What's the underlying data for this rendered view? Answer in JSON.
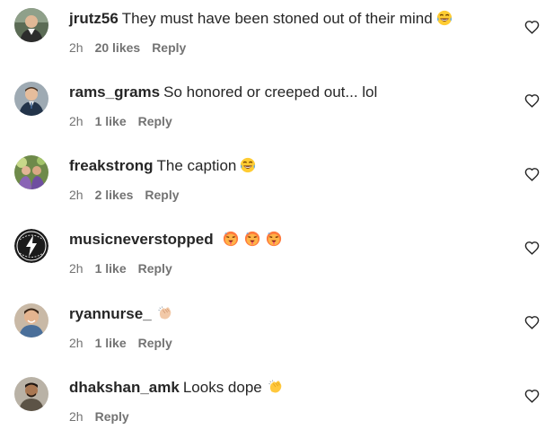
{
  "comments": [
    {
      "username": "jrutz56",
      "text": "They must have been stoned out of their mind",
      "emojis": [
        "laughing-tears-emoji"
      ],
      "time": "2h",
      "likes": "20 likes",
      "reply": "Reply",
      "avatar_icon": "avatar-photo"
    },
    {
      "username": "rams_grams",
      "text": "So honored or creeped out... lol",
      "emojis": [],
      "time": "2h",
      "likes": "1 like",
      "reply": "Reply",
      "avatar_icon": "avatar-photo"
    },
    {
      "username": "freakstrong",
      "text": "The caption",
      "emojis": [
        "laughing-tears-emoji"
      ],
      "time": "2h",
      "likes": "2 likes",
      "reply": "Reply",
      "avatar_icon": "avatar-photo"
    },
    {
      "username": "musicneverstopped",
      "text": "",
      "emojis": [
        "hot-face-emoji",
        "hot-face-emoji",
        "hot-face-emoji"
      ],
      "time": "2h",
      "likes": "1 like",
      "reply": "Reply",
      "avatar_icon": "avatar-logo"
    },
    {
      "username": "ryannurse_",
      "text": "",
      "emojis": [
        "clapping-hands-emoji"
      ],
      "time": "2h",
      "likes": "1 like",
      "reply": "Reply",
      "avatar_icon": "avatar-photo"
    },
    {
      "username": "dhakshan_amk",
      "text": "Looks dope",
      "emojis": [
        "clapping-hands-emoji"
      ],
      "time": "2h",
      "likes": "",
      "reply": "Reply",
      "avatar_icon": "avatar-photo"
    }
  ],
  "colors": {
    "text": "#262626",
    "meta": "#737373",
    "background": "#ffffff"
  }
}
